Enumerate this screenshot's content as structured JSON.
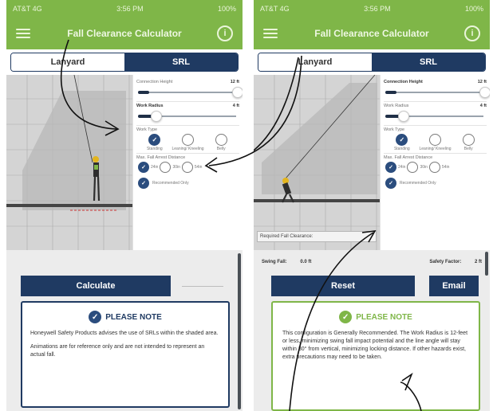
{
  "status": {
    "carrier": "AT&T 4G",
    "time": "3:56 PM",
    "battery": "100%"
  },
  "app": {
    "title": "Fall Clearance Calculator"
  },
  "tabs": [
    "Lanyard",
    "SRL"
  ],
  "settings": {
    "connection_height": {
      "label": "Connection Height",
      "value": "12 ft"
    },
    "work_radius": {
      "label": "Work Radius",
      "value": "4 ft"
    },
    "work_type": {
      "label": "Work Type",
      "options": [
        "Standing",
        "Leaning/ Kneeling",
        "Belly"
      ]
    },
    "max_fall_arrest": {
      "label": "Max. Fall Arrest Distance",
      "options": [
        "24in",
        "30in",
        "54in"
      ]
    },
    "recommended_only": "Recommended Only"
  },
  "left": {
    "calculate_label": "Calculate",
    "note": {
      "title": "PLEASE NOTE",
      "p1": "Honeywell Safety Products advises the use of SRLs within the shaded area.",
      "p2": "Animations are for reference only and are not intended to represent an actual fall."
    }
  },
  "right": {
    "required_label": "Required Fall Clearance:",
    "swing_fall_label": "Swing Fall:",
    "swing_fall_value": "0.0 ft",
    "safety_factor_label": "Safety Factor:",
    "safety_factor_value": "2 ft",
    "reset_label": "Reset",
    "email_label": "Email",
    "note": {
      "title": "PLEASE NOTE",
      "text": "This configuration is Generally Recommended. The Work Radius is 12-feet or less, minimizing swing fall impact potential and the line angle will stay within 30° from vertical, minimizing locking distance.  If other hazards exist, extra precautions may need to be taken."
    }
  },
  "colors": {
    "green": "#7fb648",
    "navy": "#1f3a62",
    "radio_selected": "#2b4d7e"
  },
  "icons": [
    "menu-icon",
    "info-icon",
    "check-circle-icon",
    "hand-drawn-arrow-icon"
  ]
}
